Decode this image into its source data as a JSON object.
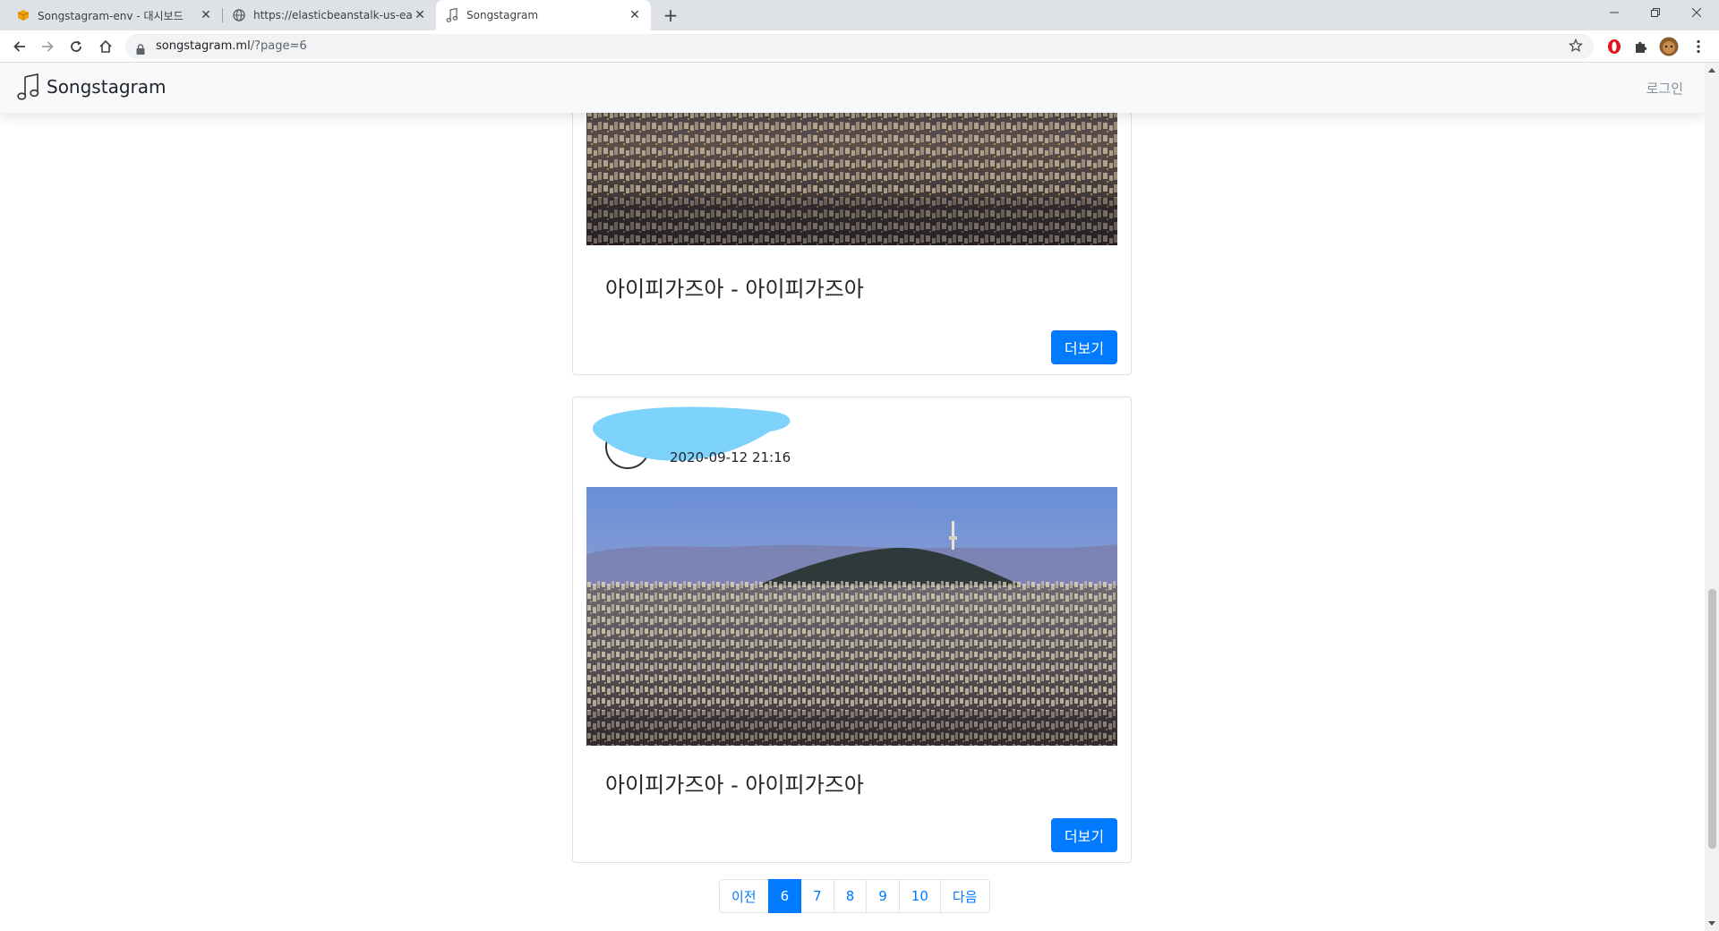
{
  "browser": {
    "tabs": [
      {
        "title": "Songstagram-env - 대시보드",
        "favicon": "aws-box-icon"
      },
      {
        "title": "https://elasticbeanstalk-us-east-",
        "favicon": "globe-icon"
      },
      {
        "title": "Songstagram",
        "favicon": "music-note-icon"
      }
    ],
    "new_tab": "+",
    "url_host": "songstagram.ml",
    "url_path": "/?page=6"
  },
  "site": {
    "brand": "Songstagram",
    "login": "로그인"
  },
  "posts": [
    {
      "title": "아이피가즈아 - 아이피가즈아",
      "more_label": "더보기"
    },
    {
      "date": "2020-09-12 21:16",
      "title": "아이피가즈아 - 아이피가즈아",
      "more_label": "더보기"
    }
  ],
  "pagination": {
    "prev": "이전",
    "pages": [
      "6",
      "7",
      "8",
      "9",
      "10"
    ],
    "current": "6",
    "next": "다음"
  },
  "colors": {
    "primary": "#007bff",
    "navbar_bg": "#f8f9fa",
    "redaction": "#7dd3fc"
  }
}
